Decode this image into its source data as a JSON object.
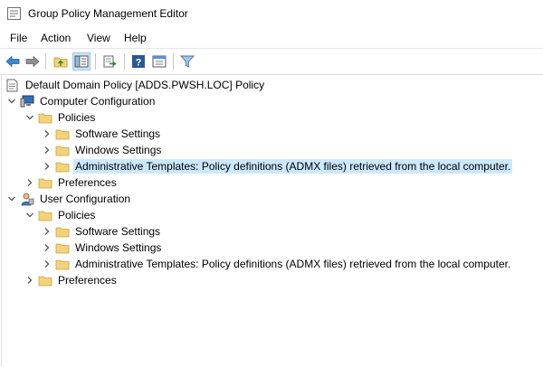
{
  "window": {
    "title": "Group Policy Management Editor"
  },
  "menu": {
    "file": "File",
    "action": "Action",
    "view": "View",
    "help": "Help"
  },
  "tree": {
    "root": "Default Domain Policy [ADDS.PWSH.LOC] Policy",
    "computer_configuration": {
      "label": "Computer Configuration",
      "policies": "Policies",
      "software_settings": "Software Settings",
      "windows_settings": "Windows Settings",
      "administrative_templates": "Administrative Templates: Policy definitions (ADMX files) retrieved from the local computer.",
      "preferences": "Preferences"
    },
    "user_configuration": {
      "label": "User Configuration",
      "policies": "Policies",
      "software_settings": "Software Settings",
      "windows_settings": "Windows Settings",
      "administrative_templates": "Administrative Templates: Policy definitions (ADMX files) retrieved from the local computer.",
      "preferences": "Preferences"
    }
  },
  "colors": {
    "selection": "#cce8ff",
    "folder": "#f3d27a",
    "toolbar_pressed": "#cce4f7"
  }
}
